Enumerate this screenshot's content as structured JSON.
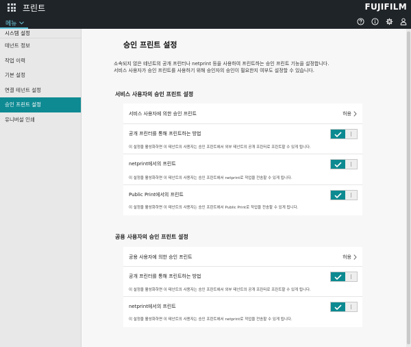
{
  "header": {
    "app_title": "프린트",
    "brand": "FUJIFILM",
    "menu_label": "메뉴",
    "icons": [
      "help-icon",
      "info-icon",
      "gear-icon",
      "user-icon"
    ]
  },
  "sidebar": {
    "heading": "시스템 설정",
    "items": [
      {
        "label": "테넌트 정보",
        "active": false
      },
      {
        "label": "작업 이력",
        "active": false
      },
      {
        "label": "기본 설정",
        "active": false
      },
      {
        "label": "연결 테넌트 설정",
        "active": false
      },
      {
        "label": "승인 프린트 설정",
        "active": true
      },
      {
        "label": "유니버설 인쇄",
        "active": false
      }
    ]
  },
  "main": {
    "title": "승인 프린트 설정",
    "intro_line1": "소속되지 않은 테넌트의 공개 프린터나 netprint 등을 사용하여 프린트하는 승인 프린트 기능을 설정합니다.",
    "intro_line2": "서비스 사용자가 승인 프린트를 사용하기 위해 승인자의 승인이 필요한지 여부도 설정할 수 있습니다.",
    "service_section": {
      "title": "서비스 사용자의 승인 프린트 설정",
      "approval_row": {
        "label": "서비스 사용자에 의한 승인 프린트",
        "value": "허용"
      },
      "toggles": [
        {
          "label": "공개 프린터를 통해 프린트하는 방법",
          "desc": "이 설정을 활성화하면 이 테넌트의 사용자는 승인 프린트에서 외부 테넌트의 공개 프린터로 프린트할 수 있게 됩니다.",
          "enabled": true
        },
        {
          "label": "netprint에서의 프린트",
          "desc": "이 설정을 활성화하면 이 테넌트의 사용자는 승인 프린트에서 netprint로 작업을 전송할 수 있게 됩니다.",
          "enabled": true
        },
        {
          "label": "Public Print에서의 프린트",
          "desc": "이 설정을 활성화하면 이 테넌트의 사용자는 승인 프린트에서 Public Print로 작업을 전송할 수 있게 됩니다.",
          "enabled": true
        }
      ]
    },
    "shared_section": {
      "title": "공용 사용자의 승인 프린트 설정",
      "approval_row": {
        "label": "공용 사용자에 의한 승인 프린트",
        "value": "허용"
      },
      "toggles": [
        {
          "label": "공개 프린터를 통해 프린트하는 방법",
          "desc": "이 설정을 활성화하면 이 테넌트의 사용자는 승인 프린트에서 외부 테넌트의 공개 프린터로 프린트할 수 있게 됩니다.",
          "enabled": true
        },
        {
          "label": "netprint에서의 프린트",
          "desc": "이 설정을 활성화하면 이 테넌트의 사용자는 승인 프린트에서 netprint로 작업을 전송할 수 있게 됩니다.",
          "enabled": true
        }
      ]
    }
  },
  "colors": {
    "accent": "#0e8a93",
    "topbar": "#1f2428",
    "menu_underline": "#5bc4dc"
  }
}
